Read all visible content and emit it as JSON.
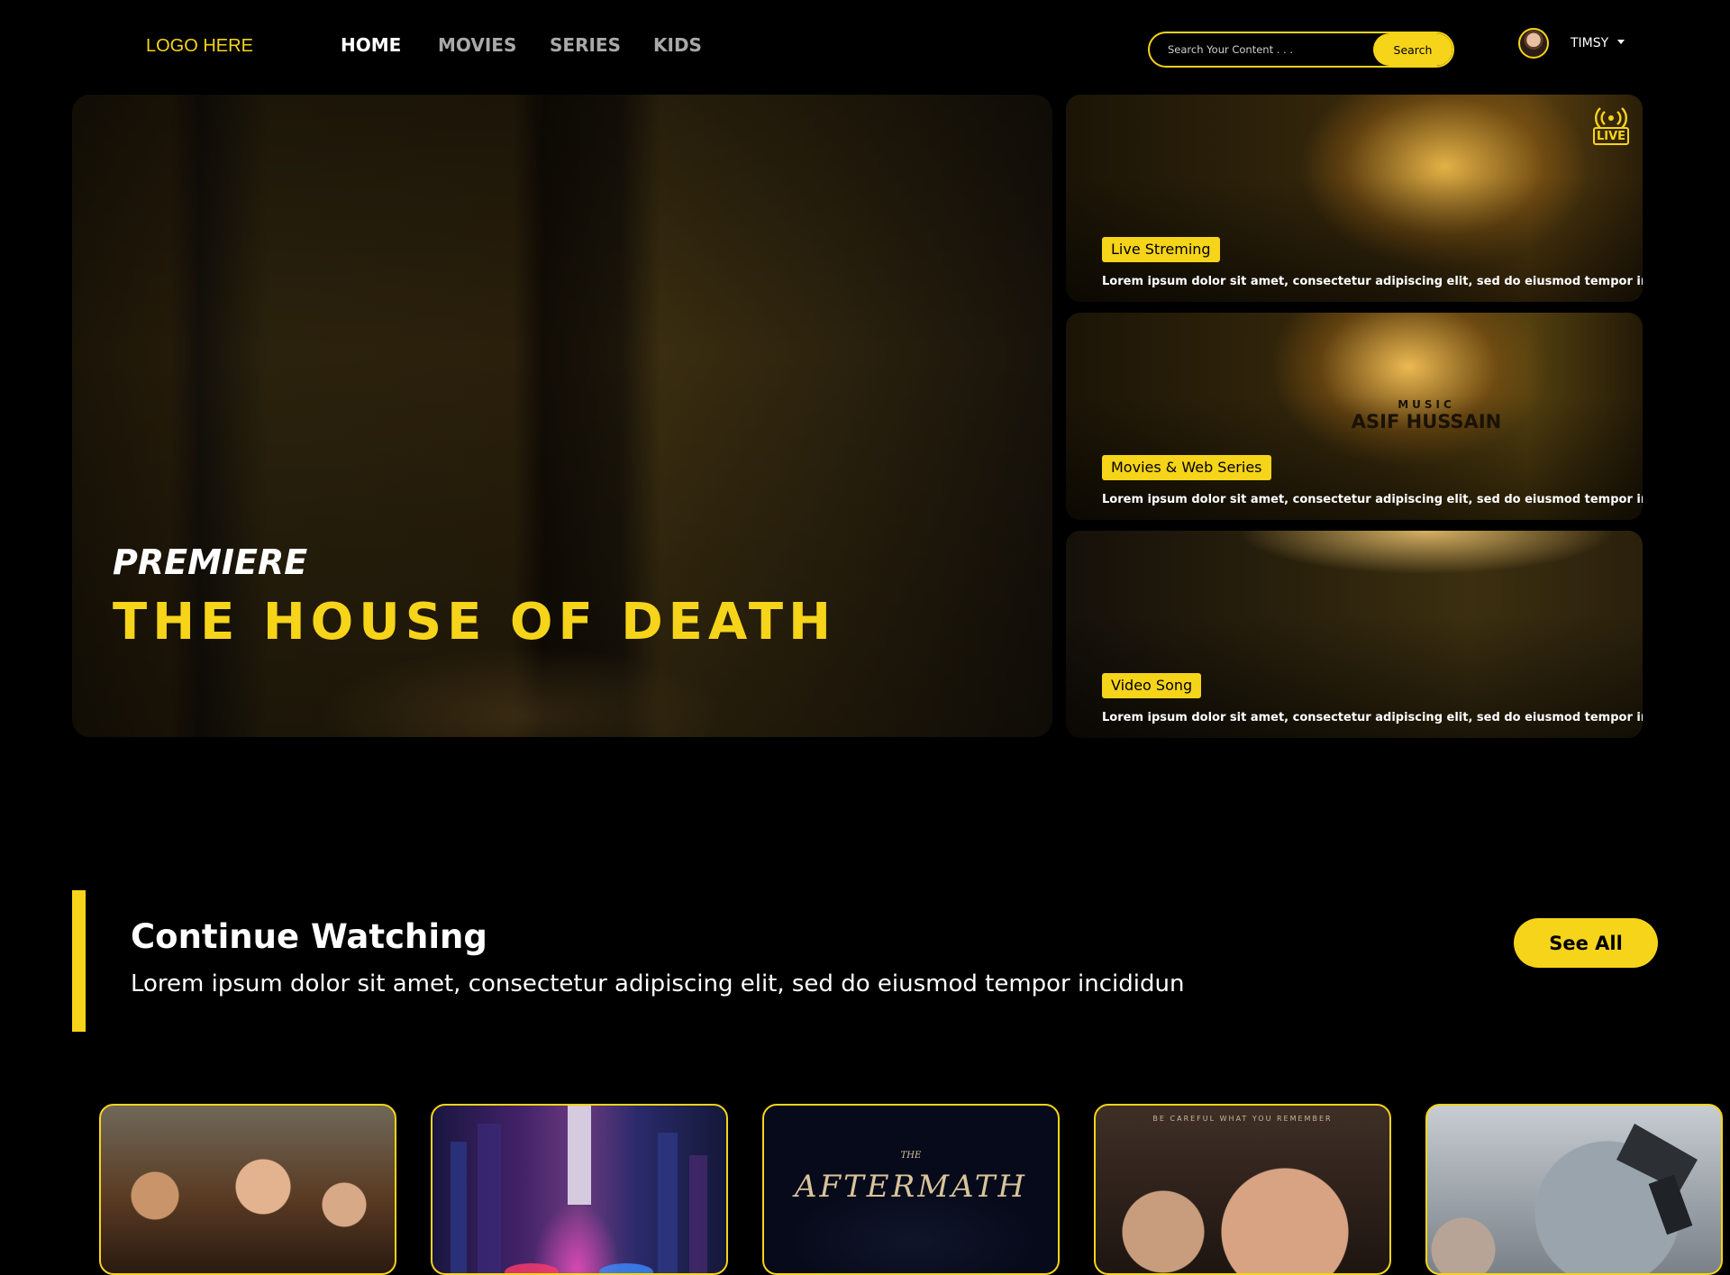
{
  "nav": {
    "logo": "LOGO HERE",
    "links": [
      "HOME",
      "MOVIES",
      "SERIES",
      "KIDS"
    ],
    "search_placeholder": "Search Your Content . . .",
    "search_button": "Search",
    "user_name": "TIMSY"
  },
  "hero": {
    "kicker": "PREMIERE",
    "title": "THE HOUSE OF DEATH"
  },
  "cards": [
    {
      "tag": "Live Streming",
      "desc": "Lorem ipsum dolor sit amet, consectetur adipiscing elit, sed do eiusmod tempor incididunt",
      "badge": "LIVE"
    },
    {
      "tag": "Movies & Web Series",
      "desc": "Lorem ipsum dolor sit amet, consectetur adipiscing elit, sed do eiusmod tempor incididunt",
      "overlay_small": "MUSIC",
      "overlay_big": "ASIF HUSSAIN"
    },
    {
      "tag": "Video Song",
      "desc": "Lorem ipsum dolor sit amet, consectetur adipiscing elit, sed do eiusmod tempor incididunt"
    }
  ],
  "continue": {
    "title": "Continue Watching",
    "subtitle": "Lorem ipsum dolor sit amet, consectetur adipiscing elit, sed do eiusmod tempor incididun",
    "see_all": "See All"
  },
  "posters": [
    {
      "name": "poster-1"
    },
    {
      "name": "poster-2"
    },
    {
      "name": "poster-3",
      "title_small": "THE",
      "title": "AFTERMATH"
    },
    {
      "name": "poster-4",
      "tagline": "BE CAREFUL WHAT YOU REMEMBER"
    },
    {
      "name": "poster-5"
    }
  ],
  "colors": {
    "accent": "#f6d419",
    "background": "#000000"
  }
}
